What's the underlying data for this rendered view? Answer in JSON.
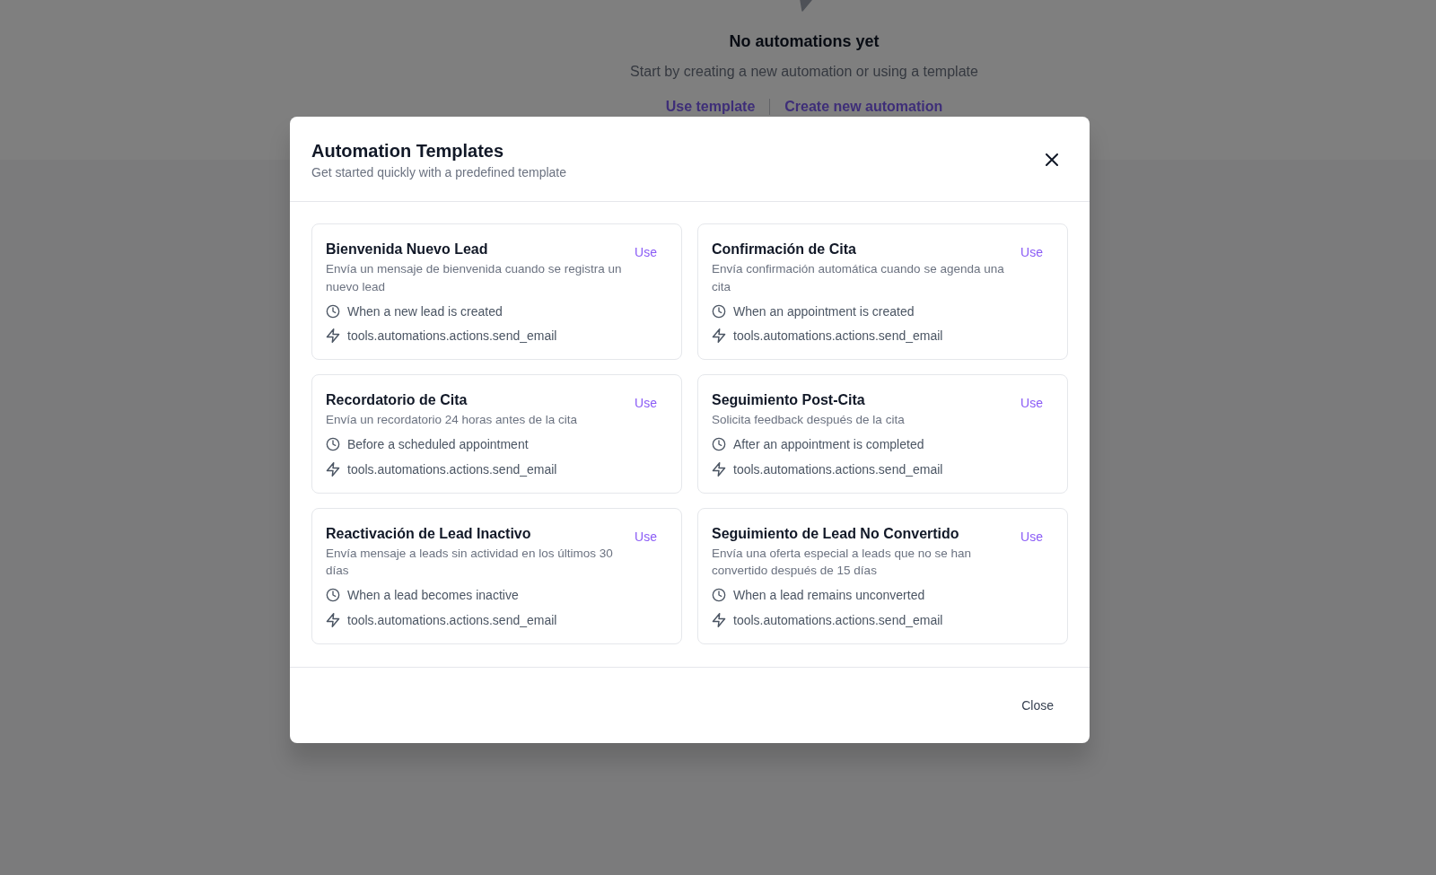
{
  "page": {
    "empty_state": {
      "title": "No automations yet",
      "subtitle": "Start by creating a new automation or using a template",
      "links": [
        {
          "label": "Use template"
        },
        {
          "label": "Create new automation"
        }
      ]
    }
  },
  "modal": {
    "title": "Automation Templates",
    "subtitle": "Get started quickly with a predefined template",
    "templates": [
      {
        "name": "Bienvenida Nuevo Lead",
        "description": "Envía un mensaje de bienvenida cuando se registra un nuevo lead",
        "trigger": "When a new lead is created",
        "action": "tools.automations.actions.send_email",
        "button": "Use"
      },
      {
        "name": "Confirmación de Cita",
        "description": "Envía confirmación automática cuando se agenda una cita",
        "trigger": "When an appointment is created",
        "action": "tools.automations.actions.send_email",
        "button": "Use"
      },
      {
        "name": "Recordatorio de Cita",
        "description": "Envía un recordatorio 24 horas antes de la cita",
        "trigger": "Before a scheduled appointment",
        "action": "tools.automations.actions.send_email",
        "button": "Use"
      },
      {
        "name": "Seguimiento Post-Cita",
        "description": "Solicita feedback después de la cita",
        "trigger": "After an appointment is completed",
        "action": "tools.automations.actions.send_email",
        "button": "Use"
      },
      {
        "name": "Reactivación de Lead Inactivo",
        "description": "Envía mensaje a leads sin actividad en los últimos 30 días",
        "trigger": "When a lead becomes inactive",
        "action": "tools.automations.actions.send_email",
        "button": "Use"
      },
      {
        "name": "Seguimiento de Lead No Convertido",
        "description": "Envía una oferta especial a leads que no se han convertido después de 15 días",
        "trigger": "When a lead remains unconverted",
        "action": "tools.automations.actions.send_email",
        "button": "Use"
      }
    ],
    "footer_button": "Close"
  }
}
